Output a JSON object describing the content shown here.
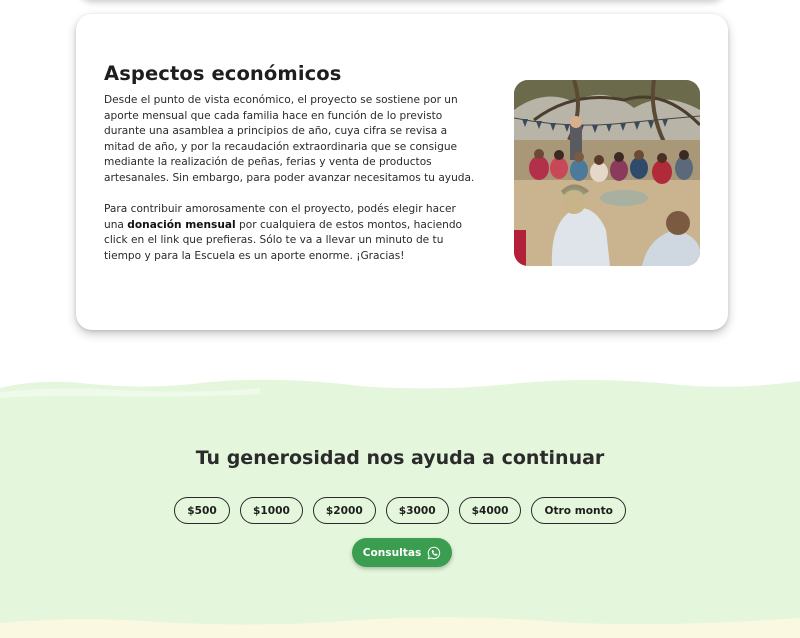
{
  "economic_section": {
    "title": "Aspectos económicos",
    "paragraph1": "Desde el punto de vista económico, el proyecto se sostiene por un aporte mensual que cada familia hace en función de lo previsto durante una asamblea a principios de año, cuya cifra se revisa a mitad de año, y por la recaudación extraordinaria que se consigue mediante la realización de peñas, ferias y venta de productos artesanales. Sin embargo, para poder avanzar necesitamos tu ayuda.",
    "paragraph2_before": "Para contribuir amorosamente con el proyecto, podés elegir hacer una ",
    "paragraph2_bold": "donación mensual",
    "paragraph2_after": " por cualquiera de estos montos, haciendo click en el link que prefieras. Sólo te va a llevar un minuto de tu tiempo y para la Escuela es un aporte enorme. ¡Gracias!"
  },
  "donation_section": {
    "title": "Tu generosidad nos ayuda a continuar",
    "amounts": [
      "$500",
      "$1000",
      "$2000",
      "$3000",
      "$4000",
      "Otro monto"
    ],
    "contact_label": "Consultas",
    "contact_icon": "whatsapp-icon"
  },
  "colors": {
    "band_green": "#e3f7dc",
    "button_green": "#3a9d4f",
    "bottom_yellow": "#fdf9e4"
  }
}
